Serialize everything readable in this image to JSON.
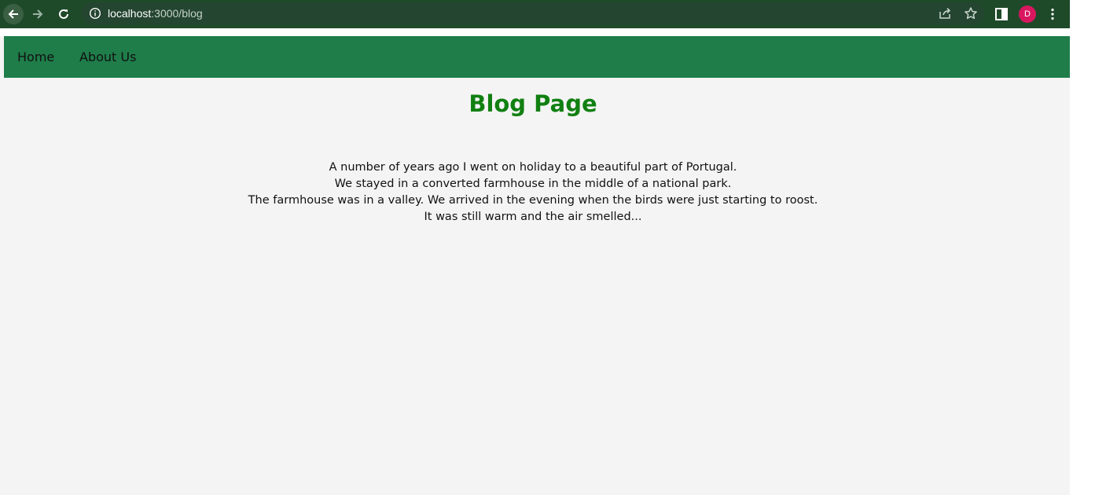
{
  "browser": {
    "url_host": "localhost",
    "url_rest": ":3000/blog",
    "profile_initial": "D",
    "icons": {
      "back": "arrow-left-icon",
      "forward": "arrow-right-icon",
      "reload": "reload-icon",
      "site_info": "info-icon",
      "share": "share-icon",
      "bookmark": "star-icon",
      "side_panel": "side-panel-icon",
      "menu": "kebab-menu-icon"
    },
    "colors": {
      "toolbar": "#1f4a2a",
      "omnibox": "#244530",
      "avatar": "#d8175f"
    }
  },
  "nav": {
    "links": [
      "Home",
      "About Us"
    ],
    "background": "#1f7d4a"
  },
  "page": {
    "title": "Blog Page",
    "title_color": "#118011",
    "paragraphs": [
      "A number of years ago I went on holiday to a beautiful part of Portugal.",
      "We stayed in a converted farmhouse in the middle of a national park.",
      "The farmhouse was in a valley. We arrived in the evening when the birds were just starting to roost.",
      "It was still warm and the air smelled..."
    ]
  }
}
